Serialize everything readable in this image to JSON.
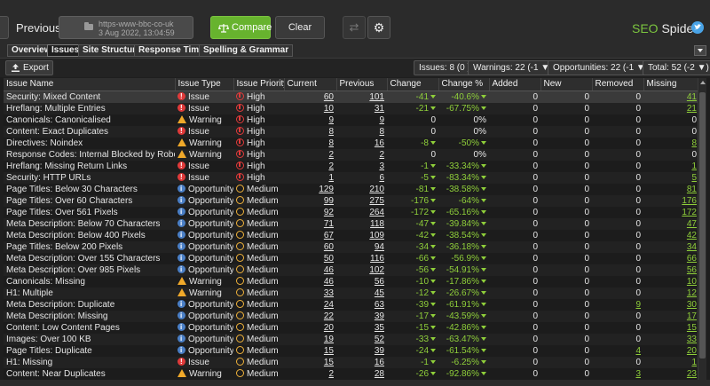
{
  "toolbar": {
    "previous_label": "Previous:",
    "previous_url": "https-www-bbc-co-uk",
    "previous_date": "3 Aug 2022, 13:04:59",
    "compare_label": "Compare",
    "clear_label": "Clear",
    "brand_seo": "SEO",
    "brand_spider": " Spider"
  },
  "tabs": [
    "Overview",
    "Issues",
    "Site Structure",
    "Response Times",
    "Spelling & Grammar"
  ],
  "filters": {
    "export_label": "Export",
    "issues": "Issues: 8 (0 )",
    "warnings": "Warnings: 22 (-1 ▼)",
    "opportunities": "Opportunities: 22 (-1 ▼)",
    "total": "Total: 52 (-2 ▼)"
  },
  "table": {
    "columns": [
      "Issue Name",
      "Issue Type",
      "Issue Priority",
      "Current",
      "Previous",
      "Change",
      "Change %",
      "Added",
      "New",
      "Removed",
      "Missing"
    ],
    "rows": [
      {
        "name": "Security: Mixed Content",
        "type": "Issue",
        "priority": "High",
        "current": "60",
        "previous": "101",
        "change": "-41",
        "change_pct": "-40.6%",
        "added": "0",
        "new": "0",
        "removed": "0",
        "missing": "41"
      },
      {
        "name": "Hreflang: Multiple Entries",
        "type": "Issue",
        "priority": "High",
        "current": "10",
        "previous": "31",
        "change": "-21",
        "change_pct": "-67.75%",
        "added": "0",
        "new": "0",
        "removed": "0",
        "missing": "21"
      },
      {
        "name": "Canonicals: Canonicalised",
        "type": "Warning",
        "priority": "High",
        "current": "9",
        "previous": "9",
        "change": "0",
        "change_pct": "0%",
        "added": "0",
        "new": "0",
        "removed": "0",
        "missing": "0"
      },
      {
        "name": "Content: Exact Duplicates",
        "type": "Issue",
        "priority": "High",
        "current": "8",
        "previous": "8",
        "change": "0",
        "change_pct": "0%",
        "added": "0",
        "new": "0",
        "removed": "0",
        "missing": "0"
      },
      {
        "name": "Directives: Noindex",
        "type": "Warning",
        "priority": "High",
        "current": "8",
        "previous": "16",
        "change": "-8",
        "change_pct": "-50%",
        "added": "0",
        "new": "0",
        "removed": "0",
        "missing": "8"
      },
      {
        "name": "Response Codes: Internal Blocked by Robots.txt",
        "type": "Warning",
        "priority": "High",
        "current": "2",
        "previous": "2",
        "change": "0",
        "change_pct": "0%",
        "added": "0",
        "new": "0",
        "removed": "0",
        "missing": "0"
      },
      {
        "name": "Hreflang: Missing Return Links",
        "type": "Issue",
        "priority": "High",
        "current": "2",
        "previous": "3",
        "change": "-1",
        "change_pct": "-33.34%",
        "added": "0",
        "new": "0",
        "removed": "0",
        "missing": "1"
      },
      {
        "name": "Security: HTTP URLs",
        "type": "Issue",
        "priority": "High",
        "current": "1",
        "previous": "6",
        "change": "-5",
        "change_pct": "-83.34%",
        "added": "0",
        "new": "0",
        "removed": "0",
        "missing": "5"
      },
      {
        "name": "Page Titles: Below 30 Characters",
        "type": "Opportunity",
        "priority": "Medium",
        "current": "129",
        "previous": "210",
        "change": "-81",
        "change_pct": "-38.58%",
        "added": "0",
        "new": "0",
        "removed": "0",
        "missing": "81"
      },
      {
        "name": "Page Titles: Over 60 Characters",
        "type": "Opportunity",
        "priority": "Medium",
        "current": "99",
        "previous": "275",
        "change": "-176",
        "change_pct": "-64%",
        "added": "0",
        "new": "0",
        "removed": "0",
        "missing": "176"
      },
      {
        "name": "Page Titles: Over 561 Pixels",
        "type": "Opportunity",
        "priority": "Medium",
        "current": "92",
        "previous": "264",
        "change": "-172",
        "change_pct": "-65.16%",
        "added": "0",
        "new": "0",
        "removed": "0",
        "missing": "172"
      },
      {
        "name": "Meta Description: Below 70 Characters",
        "type": "Opportunity",
        "priority": "Medium",
        "current": "71",
        "previous": "118",
        "change": "-47",
        "change_pct": "-39.84%",
        "added": "0",
        "new": "0",
        "removed": "0",
        "missing": "47"
      },
      {
        "name": "Meta Description: Below 400 Pixels",
        "type": "Opportunity",
        "priority": "Medium",
        "current": "67",
        "previous": "109",
        "change": "-42",
        "change_pct": "-38.54%",
        "added": "0",
        "new": "0",
        "removed": "0",
        "missing": "42"
      },
      {
        "name": "Page Titles: Below 200 Pixels",
        "type": "Opportunity",
        "priority": "Medium",
        "current": "60",
        "previous": "94",
        "change": "-34",
        "change_pct": "-36.18%",
        "added": "0",
        "new": "0",
        "removed": "0",
        "missing": "34"
      },
      {
        "name": "Meta Description: Over 155 Characters",
        "type": "Opportunity",
        "priority": "Medium",
        "current": "50",
        "previous": "116",
        "change": "-66",
        "change_pct": "-56.9%",
        "added": "0",
        "new": "0",
        "removed": "0",
        "missing": "66"
      },
      {
        "name": "Meta Description: Over 985 Pixels",
        "type": "Opportunity",
        "priority": "Medium",
        "current": "46",
        "previous": "102",
        "change": "-56",
        "change_pct": "-54.91%",
        "added": "0",
        "new": "0",
        "removed": "0",
        "missing": "56"
      },
      {
        "name": "Canonicals: Missing",
        "type": "Warning",
        "priority": "Medium",
        "current": "46",
        "previous": "56",
        "change": "-10",
        "change_pct": "-17.86%",
        "added": "0",
        "new": "0",
        "removed": "0",
        "missing": "10"
      },
      {
        "name": "H1: Multiple",
        "type": "Warning",
        "priority": "Medium",
        "current": "33",
        "previous": "45",
        "change": "-12",
        "change_pct": "-26.67%",
        "added": "0",
        "new": "0",
        "removed": "0",
        "missing": "12"
      },
      {
        "name": "Meta Description: Duplicate",
        "type": "Opportunity",
        "priority": "Medium",
        "current": "24",
        "previous": "63",
        "change": "-39",
        "change_pct": "-61.91%",
        "added": "0",
        "new": "0",
        "removed": "9",
        "missing": "30"
      },
      {
        "name": "Meta Description: Missing",
        "type": "Opportunity",
        "priority": "Medium",
        "current": "22",
        "previous": "39",
        "change": "-17",
        "change_pct": "-43.59%",
        "added": "0",
        "new": "0",
        "removed": "0",
        "missing": "17"
      },
      {
        "name": "Content: Low Content Pages",
        "type": "Opportunity",
        "priority": "Medium",
        "current": "20",
        "previous": "35",
        "change": "-15",
        "change_pct": "-42.86%",
        "added": "0",
        "new": "0",
        "removed": "0",
        "missing": "15"
      },
      {
        "name": "Images: Over 100 KB",
        "type": "Opportunity",
        "priority": "Medium",
        "current": "19",
        "previous": "52",
        "change": "-33",
        "change_pct": "-63.47%",
        "added": "0",
        "new": "0",
        "removed": "0",
        "missing": "33"
      },
      {
        "name": "Page Titles: Duplicate",
        "type": "Opportunity",
        "priority": "Medium",
        "current": "15",
        "previous": "39",
        "change": "-24",
        "change_pct": "-61.54%",
        "added": "0",
        "new": "0",
        "removed": "4",
        "missing": "20"
      },
      {
        "name": "H1: Missing",
        "type": "Issue",
        "priority": "Medium",
        "current": "15",
        "previous": "16",
        "change": "-1",
        "change_pct": "-6.25%",
        "added": "0",
        "new": "0",
        "removed": "0",
        "missing": "1"
      },
      {
        "name": "Content: Near Duplicates",
        "type": "Warning",
        "priority": "Medium",
        "current": "2",
        "previous": "28",
        "change": "-26",
        "change_pct": "-92.86%",
        "added": "0",
        "new": "0",
        "removed": "3",
        "missing": "23"
      }
    ]
  },
  "colors": {
    "accent_green": "#67b32e",
    "change_green": "#8fcf3a",
    "issue_red": "#e03a3a",
    "warning_orange": "#f0a92a",
    "opportunity_blue": "#4a7fc6",
    "medium_yellow": "#f0b23a"
  },
  "icons": {
    "issue": "exclamation-circle-icon",
    "warning": "warning-triangle-icon",
    "opportunity": "info-circle-icon",
    "high": "high-priority-icon",
    "medium": "medium-priority-icon"
  }
}
